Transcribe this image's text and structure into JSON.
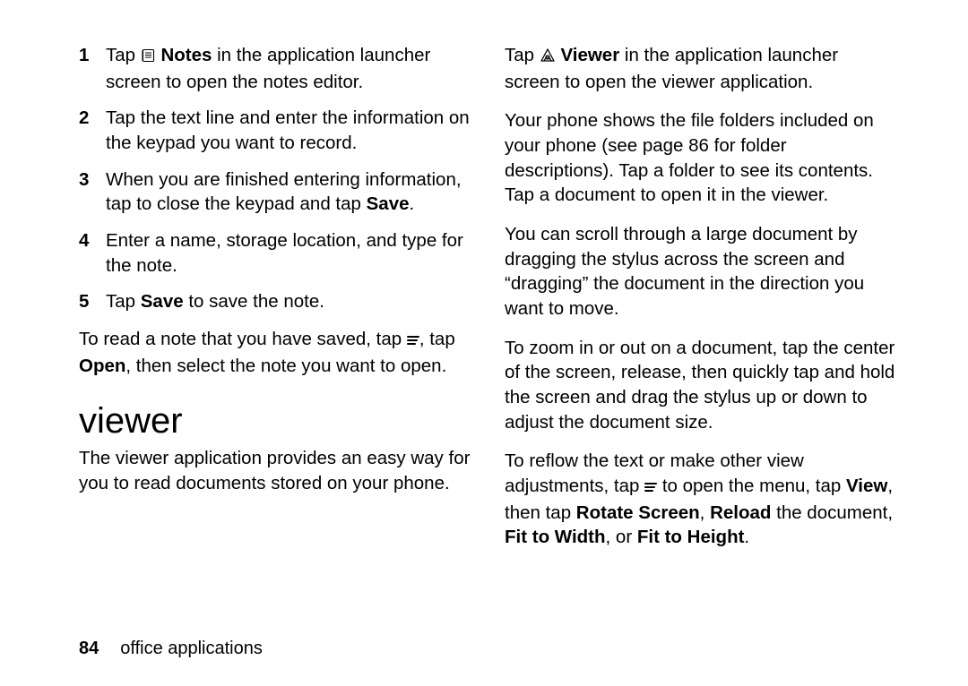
{
  "left": {
    "steps": [
      {
        "n": "1",
        "pre": "Tap ",
        "icon": "notes",
        "bold": "Notes",
        "post": " in the application launcher screen to open the notes editor."
      },
      {
        "n": "2",
        "text": "Tap the text line and enter the information on the keypad you want to record."
      },
      {
        "n": "3",
        "pre": "When you are finished entering information, tap to close the keypad and tap ",
        "bold": "Save",
        "post": "."
      },
      {
        "n": "4",
        "text": "Enter a name, storage location, and type for the note."
      },
      {
        "n": "5",
        "pre": "Tap ",
        "bold": "Save",
        "post": " to save the note."
      }
    ],
    "read_note_pre": "To read a note that you have saved, tap ",
    "read_note_mid": ", tap ",
    "read_note_open": "Open",
    "read_note_post": ", then select the note you want to open.",
    "heading": "viewer",
    "viewer_desc": "The viewer application provides an easy way for you to read documents stored on your phone."
  },
  "right": {
    "p1_pre": "Tap ",
    "p1_bold": "Viewer",
    "p1_post": " in the application launcher screen to open the viewer application.",
    "p2": "Your phone shows the file folders included on your phone (see page 86 for folder descriptions). Tap a folder to see its contents. Tap a document to open it in the viewer.",
    "p3": "You can scroll through a large document by dragging the stylus across the screen and “dragging” the document in the direction you want to move.",
    "p4": "To zoom in or out on a document, tap the center of the screen, release, then quickly tap and hold the screen and drag the stylus up or down to adjust the document size.",
    "p5_a": "To reflow the text or make other view adjustments, tap ",
    "p5_b": " to open the menu, tap ",
    "p5_view": "View",
    "p5_c": ", then tap ",
    "p5_rotate": "Rotate Screen",
    "p5_d": ", ",
    "p5_reload": "Reload",
    "p5_e": " the document, ",
    "p5_fitw": "Fit to Width",
    "p5_f": ", or ",
    "p5_fith": "Fit to Height",
    "p5_g": "."
  },
  "footer": {
    "page": "84",
    "section": "office applications"
  }
}
